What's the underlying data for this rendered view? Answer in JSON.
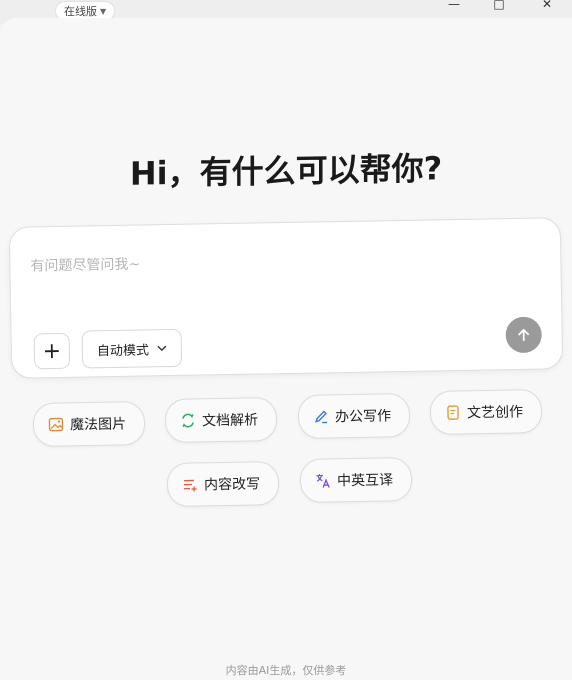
{
  "topbar": {
    "version_label": "在线版"
  },
  "main": {
    "headline": "Hi，有什么可以帮你?",
    "input": {
      "placeholder": "有问题尽管问我~",
      "mode_label": "自动模式"
    },
    "quick_actions": [
      {
        "label": "魔法图片",
        "icon": "magic-image-icon",
        "color": "#e08a3c"
      },
      {
        "label": "文档解析",
        "icon": "doc-parse-icon",
        "color": "#2eaa6a"
      },
      {
        "label": "办公写作",
        "icon": "pen-icon",
        "color": "#3b7bdb"
      },
      {
        "label": "文艺创作",
        "icon": "doc-create-icon",
        "color": "#e0a030"
      },
      {
        "label": "内容改写",
        "icon": "rewrite-icon",
        "color": "#e0604a"
      },
      {
        "label": "中英互译",
        "icon": "translate-icon",
        "color": "#7a4fc8"
      }
    ],
    "footer_note": "内容由AI生成，仅供参考"
  }
}
